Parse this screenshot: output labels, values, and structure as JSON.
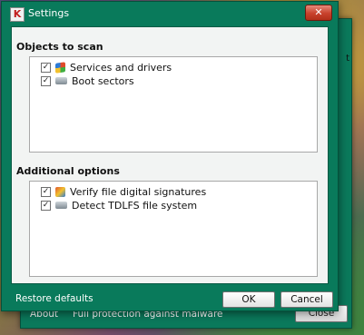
{
  "window": {
    "title": "Settings"
  },
  "objects_to_scan": {
    "title": "Objects to scan",
    "items": [
      {
        "label": "Services and drivers",
        "checked": true,
        "icon": "windows-logo-icon"
      },
      {
        "label": "Boot sectors",
        "checked": true,
        "icon": "drive-icon"
      }
    ]
  },
  "additional_options": {
    "title": "Additional options",
    "items": [
      {
        "label": "Verify file digital signatures",
        "checked": true,
        "icon": "signature-icon"
      },
      {
        "label": "Detect TDLFS file system",
        "checked": true,
        "icon": "drive-icon"
      }
    ]
  },
  "footer": {
    "restore": "Restore defaults",
    "ok": "OK",
    "cancel": "Cancel"
  },
  "background_window": {
    "about": "About",
    "status": "Full protection against malware",
    "close": "Close",
    "edge_text": "t"
  },
  "colors": {
    "frame": "#097a5b",
    "close_button": "#c8412c"
  }
}
